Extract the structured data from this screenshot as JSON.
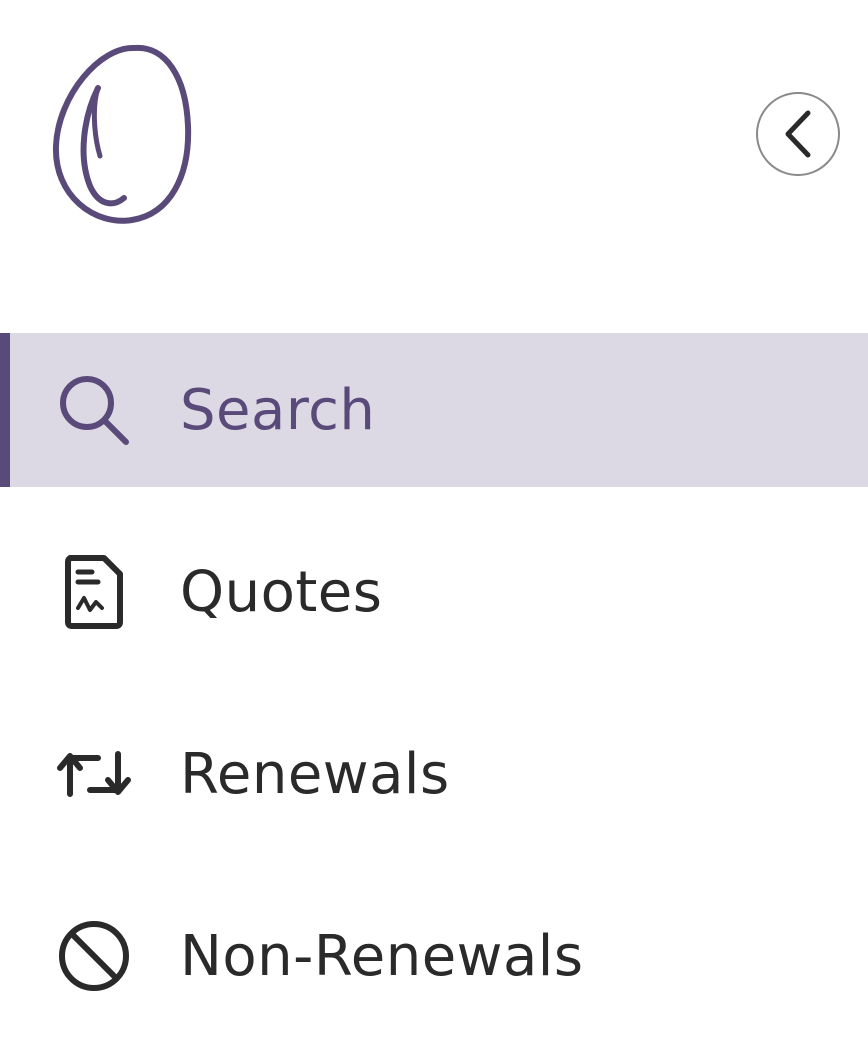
{
  "colors": {
    "brand": "#5a4a7a",
    "active_bg": "#dcd9e4",
    "text": "#2a2a2a",
    "icon": "#2a2a2a",
    "button_border": "#8a8a8a"
  },
  "header": {
    "logo_icon": "script-o-logo-icon",
    "collapse_icon": "chevron-left-icon"
  },
  "nav": {
    "active_index": 0,
    "items": [
      {
        "label": "Search",
        "icon": "search-icon"
      },
      {
        "label": "Quotes",
        "icon": "document-signature-icon"
      },
      {
        "label": "Renewals",
        "icon": "repeat-arrows-icon"
      },
      {
        "label": "Non-Renewals",
        "icon": "prohibited-icon"
      }
    ]
  }
}
